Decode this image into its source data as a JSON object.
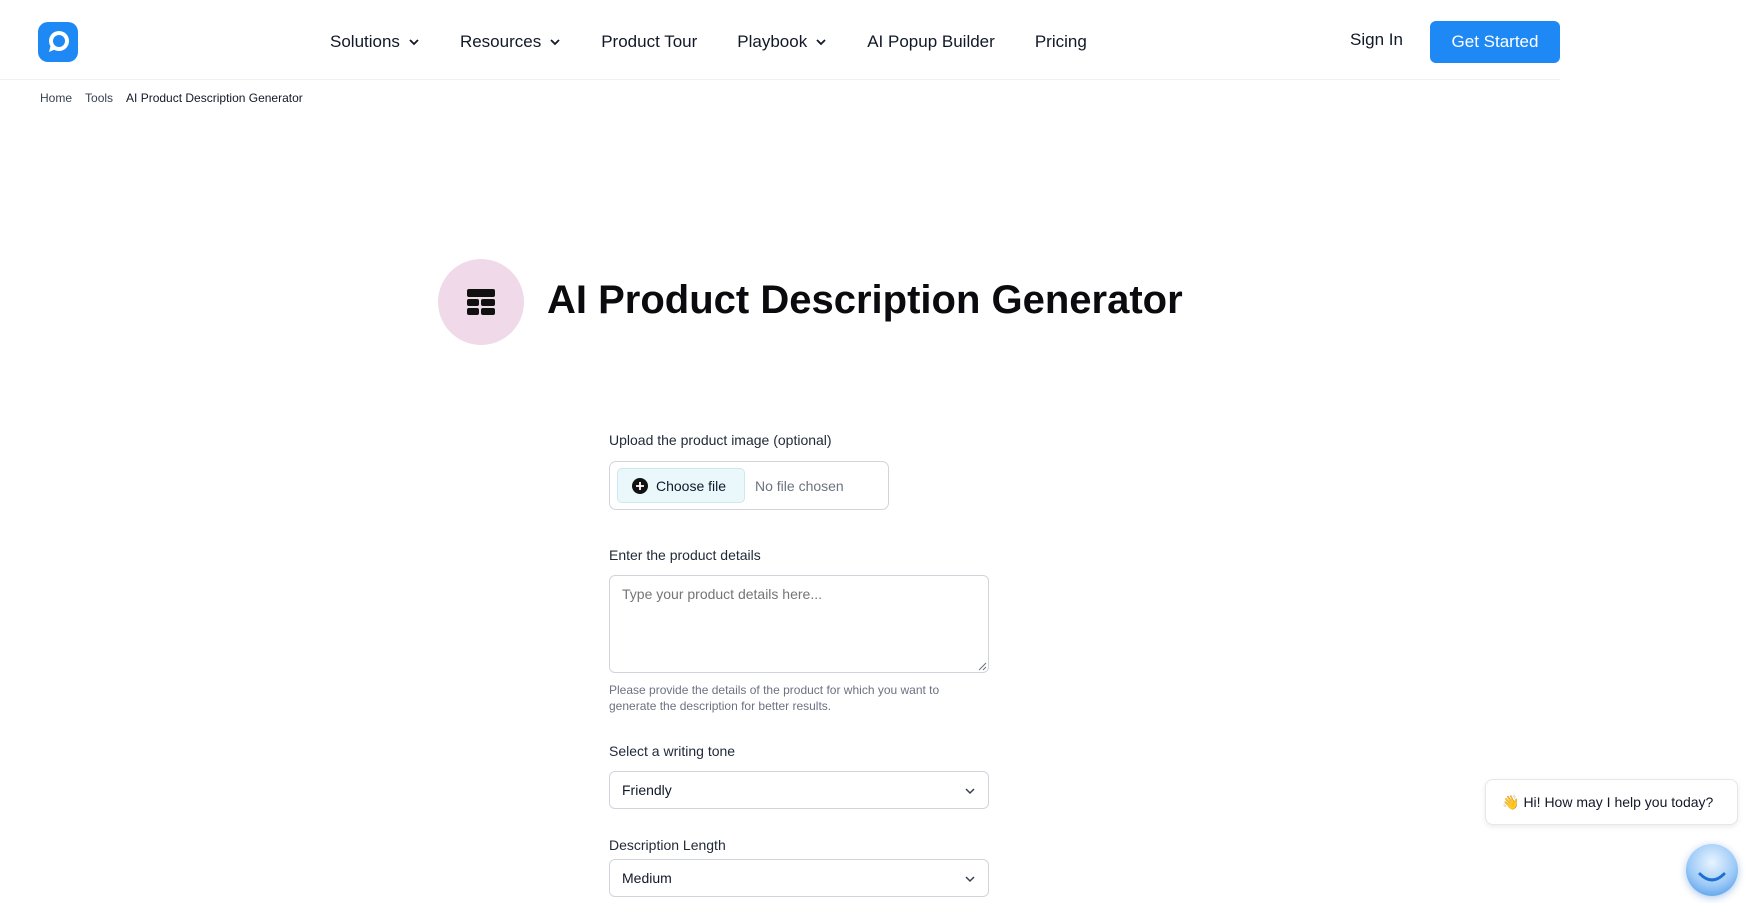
{
  "header": {
    "logo_icon": "speech-bubble-logo-icon",
    "brand_color": "#1e88f5",
    "nav": [
      {
        "label": "Solutions",
        "has_dropdown": true
      },
      {
        "label": "Resources",
        "has_dropdown": true
      },
      {
        "label": "Product Tour",
        "has_dropdown": false
      },
      {
        "label": "Playbook",
        "has_dropdown": true
      },
      {
        "label": "AI Popup Builder",
        "has_dropdown": false
      },
      {
        "label": "Pricing",
        "has_dropdown": false
      }
    ],
    "sign_in": "Sign In",
    "get_started": "Get Started"
  },
  "breadcrumb": {
    "items": [
      "Home",
      "Tools",
      "AI Product Description Generator"
    ]
  },
  "page": {
    "title": "AI Product Description Generator",
    "title_icon": "table-layout-icon",
    "icon_bg": "#f0d9e8"
  },
  "form": {
    "upload_label": "Upload the product image (optional)",
    "choose_file": "Choose file",
    "no_file": "No file chosen",
    "details_label": "Enter the product details",
    "details_placeholder": "Type your product details here...",
    "details_helper": "Please provide the details of the product for which you want to generate the description for better results.",
    "tone_label": "Select a writing tone",
    "tone_value": "Friendly",
    "length_label": "Description Length",
    "length_value": "Medium"
  },
  "chat": {
    "greeting_emoji": "👋",
    "greeting": "Hi! How may I help you today?",
    "launcher_icon": "chat-assistant-icon"
  }
}
